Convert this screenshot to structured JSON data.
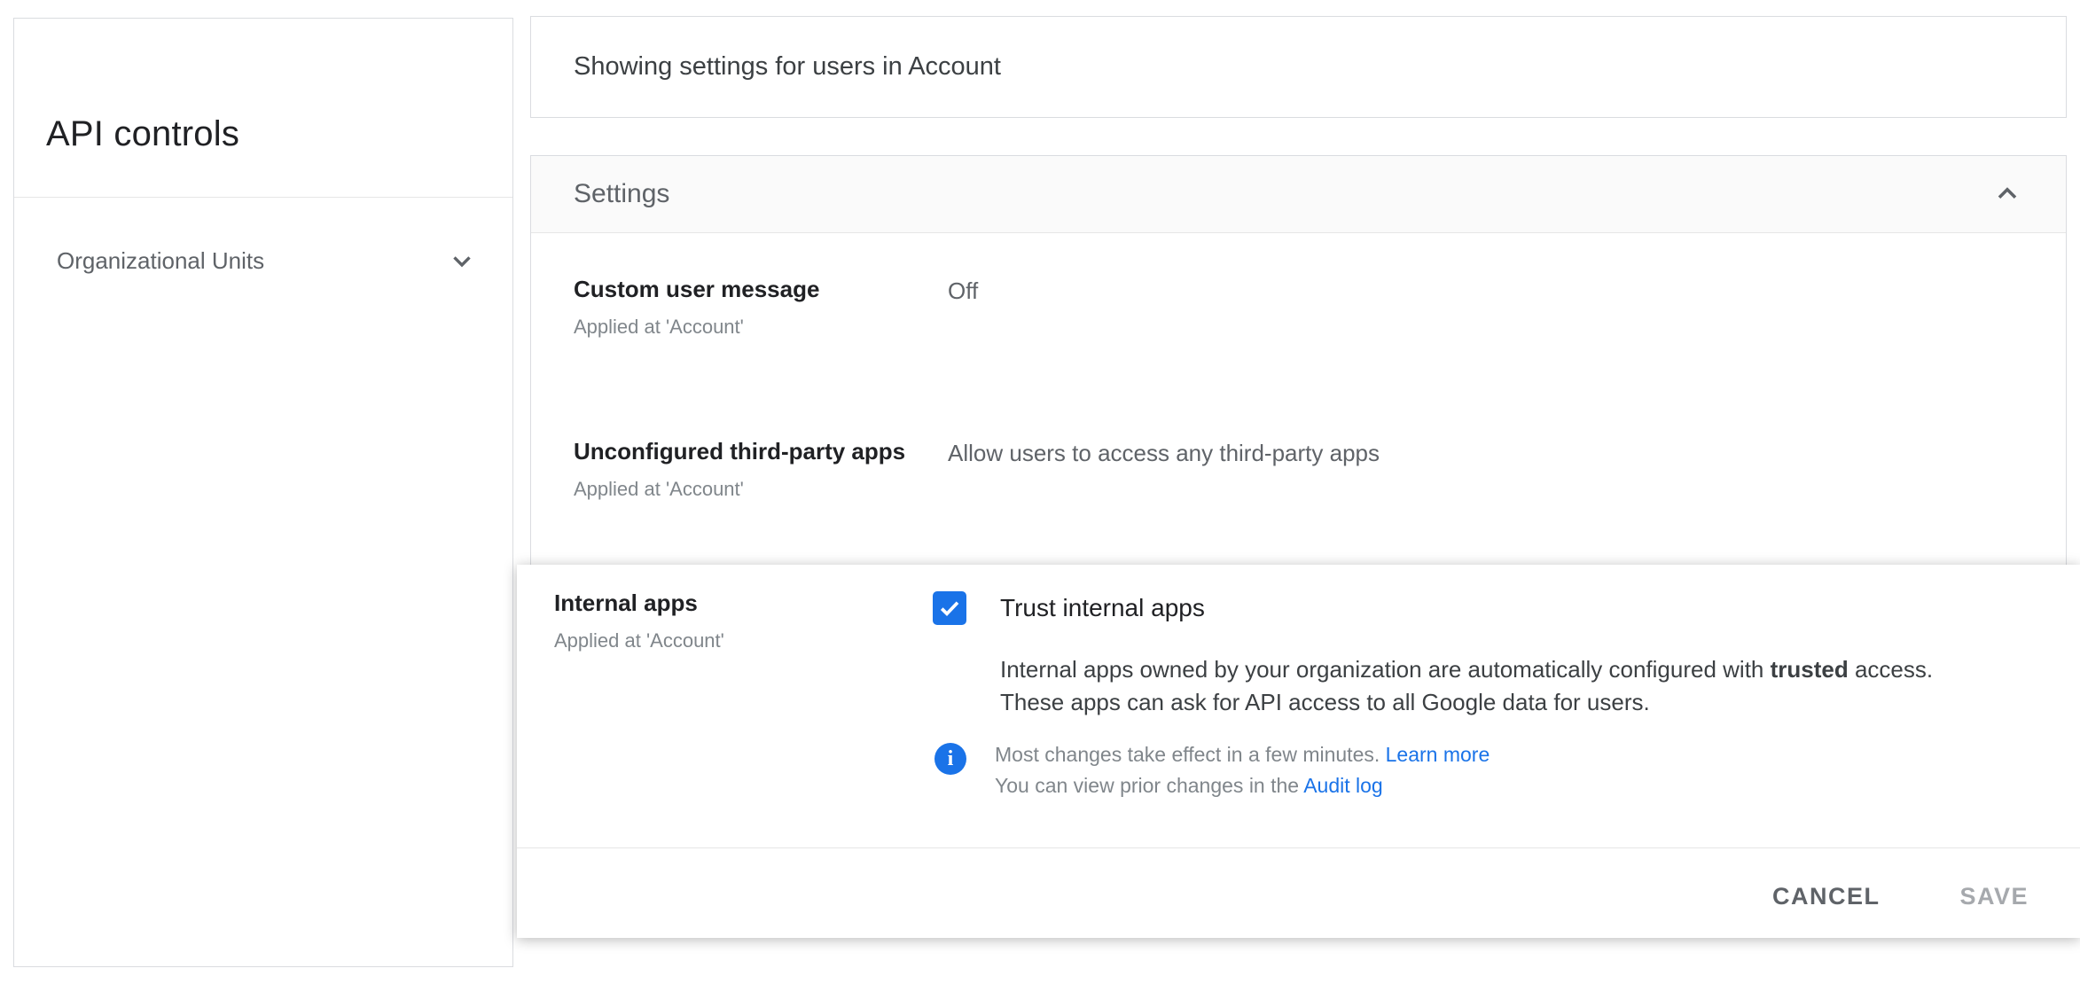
{
  "sidebar": {
    "title": "API controls",
    "items": [
      {
        "label": "Organizational Units",
        "icon": "chevron-down-icon"
      }
    ]
  },
  "topbar": {
    "scope_text": "Showing settings for users in Account"
  },
  "settings_panel": {
    "header": "Settings",
    "collapse_icon": "chevron-up-icon",
    "rows": [
      {
        "label": "Custom user message",
        "applied_at": "Applied at 'Account'",
        "value": "Off"
      },
      {
        "label": "Unconfigured third-party apps",
        "applied_at": "Applied at 'Account'",
        "value": "Allow users to access any third-party apps"
      }
    ]
  },
  "internal_apps_card": {
    "label": "Internal apps",
    "applied_at": "Applied at 'Account'",
    "checkbox": {
      "checked": true,
      "label": "Trust internal apps"
    },
    "description": {
      "line1_pre": "Internal apps owned by your organization are automatically configured with ",
      "line1_bold": "trusted",
      "line1_post": " access.",
      "line2": "These apps can ask for API access to all Google data for users."
    },
    "note": {
      "icon": "info-icon",
      "info_glyph": "i",
      "line1_text": "Most changes take effect in a few minutes. ",
      "line1_link": "Learn more",
      "line2_text": "You can view prior changes in the ",
      "line2_link": "Audit log"
    },
    "actions": {
      "cancel": "CANCEL",
      "save": "SAVE",
      "save_enabled": false
    }
  },
  "colors": {
    "accent_blue": "#1a73e8",
    "text_primary": "#202124",
    "text_secondary": "#5f6368",
    "text_tertiary": "#80868b",
    "card_border": "#dadce0",
    "panel_header_bg": "#fafafa",
    "disabled_button": "#a6a9ad"
  }
}
